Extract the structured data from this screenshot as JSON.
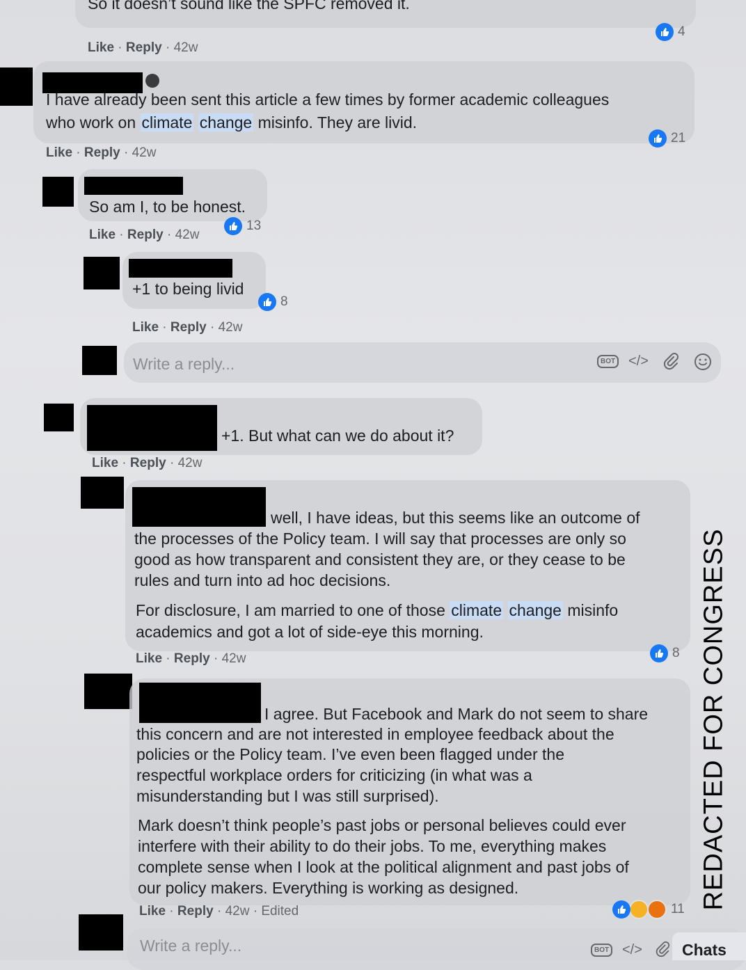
{
  "comments": [
    {
      "text": "So it doesn’t sound like the SPFC removed it.",
      "reactions": "4",
      "like": "Like",
      "reply": "Reply",
      "time": "42w"
    },
    {
      "text_a": "I have already been sent this article a few times by former academic colleagues",
      "text_b_pre": "who work on ",
      "hl1": "climate",
      "hl2": "change",
      "text_b_post": " misinfo. They are livid.",
      "reactions": "21",
      "like": "Like",
      "reply": "Reply",
      "time": "42w"
    },
    {
      "text": "So am I, to be honest.",
      "reactions": "13",
      "like": "Like",
      "reply": "Reply",
      "time": "42w"
    },
    {
      "text": "+1 to being livid",
      "reactions": "8",
      "like": "Like",
      "reply": "Reply",
      "time": "42w"
    },
    {
      "text": "+1. But what can we do about it?",
      "like": "Like",
      "reply": "Reply",
      "time": "42w"
    },
    {
      "lines": [
        "well, I have ideas, but this seems like an outcome of",
        "the processes of the Policy team. I will say that processes are only so",
        "good as how transparent and consistent they are, or they cease to be",
        "rules and turn into ad hoc decisions."
      ],
      "p2_pre": "For disclosure, I am married to one of those ",
      "hl1": "climate",
      "hl2": "change",
      "p2_post": " misinfo",
      "p2_line2": "academics and got a lot of side-eye this morning.",
      "reactions": "8",
      "like": "Like",
      "reply": "Reply",
      "time": "42w"
    },
    {
      "lines": [
        "I agree. But Facebook and Mark do not seem to share",
        "this concern and are not interested in employee feedback about the",
        "policies or the Policy team. I’ve even been flagged under the",
        "respectful workplace orders for criticizing (in what was a",
        "misunderstanding but I was still surprised)."
      ],
      "p2": [
        "Mark doesn’t think people’s past jobs or personal believes could ever",
        "interfere with their ability to do their jobs. To me, everything makes",
        "complete sense when I look at the political alignment and past jobs of",
        "our policy makers. Everything is working as designed."
      ],
      "reactions": "11",
      "like": "Like",
      "reply": "Reply",
      "time": "42w",
      "edited": "Edited"
    }
  ],
  "reply_boxes": [
    {
      "placeholder": "Write a reply..."
    },
    {
      "placeholder": "Write a reply..."
    }
  ],
  "toolbar": {
    "bot_label": "BOT",
    "code_label": "</>"
  },
  "chats_label": "Chats",
  "watermark": "REDACTED FOR CONGRESS",
  "colors": {
    "like_blue": "#1877f2",
    "highlight": "#c9dcf5",
    "sad": "#f7b125",
    "angry": "#e9710f"
  }
}
